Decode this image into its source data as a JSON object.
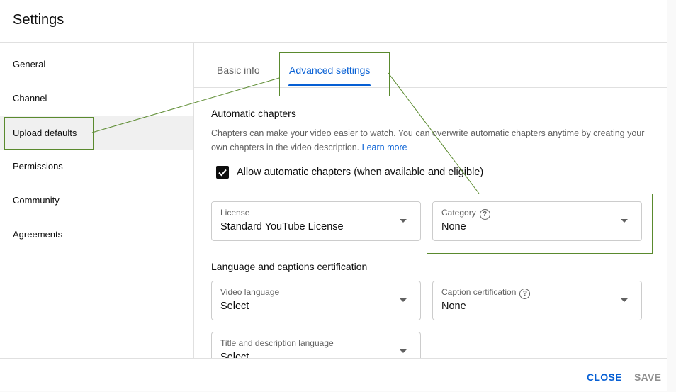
{
  "dialog": {
    "title": "Settings"
  },
  "sidebar": {
    "items": [
      {
        "label": "General",
        "active": false
      },
      {
        "label": "Channel",
        "active": false
      },
      {
        "label": "Upload defaults",
        "active": true
      },
      {
        "label": "Permissions",
        "active": false
      },
      {
        "label": "Community",
        "active": false
      },
      {
        "label": "Agreements",
        "active": false
      }
    ]
  },
  "tabs": [
    {
      "label": "Basic info",
      "active": false
    },
    {
      "label": "Advanced settings",
      "active": true
    }
  ],
  "automatic_chapters": {
    "title": "Automatic chapters",
    "description": "Chapters can make your video easier to watch. You can overwrite automatic chapters anytime by creating your own chapters in the video description.",
    "learn_more": "Learn more",
    "checkbox_label": "Allow automatic chapters (when available and eligible)",
    "checked": true
  },
  "license": {
    "label": "License",
    "value": "Standard YouTube License"
  },
  "category": {
    "label": "Category",
    "value": "None",
    "help_icon": "?"
  },
  "language_section": {
    "title": "Language and captions certification",
    "video_language": {
      "label": "Video language",
      "value": "Select"
    },
    "caption_certification": {
      "label": "Caption certification",
      "value": "None",
      "help_icon": "?"
    },
    "title_desc_language": {
      "label": "Title and description language",
      "value": "Select"
    }
  },
  "footer": {
    "close_label": "CLOSE",
    "save_label": "SAVE"
  },
  "colors": {
    "accent": "#065fd4",
    "annotation": "#5a8a2e",
    "active_nav_bg": "#f0f0f0"
  }
}
